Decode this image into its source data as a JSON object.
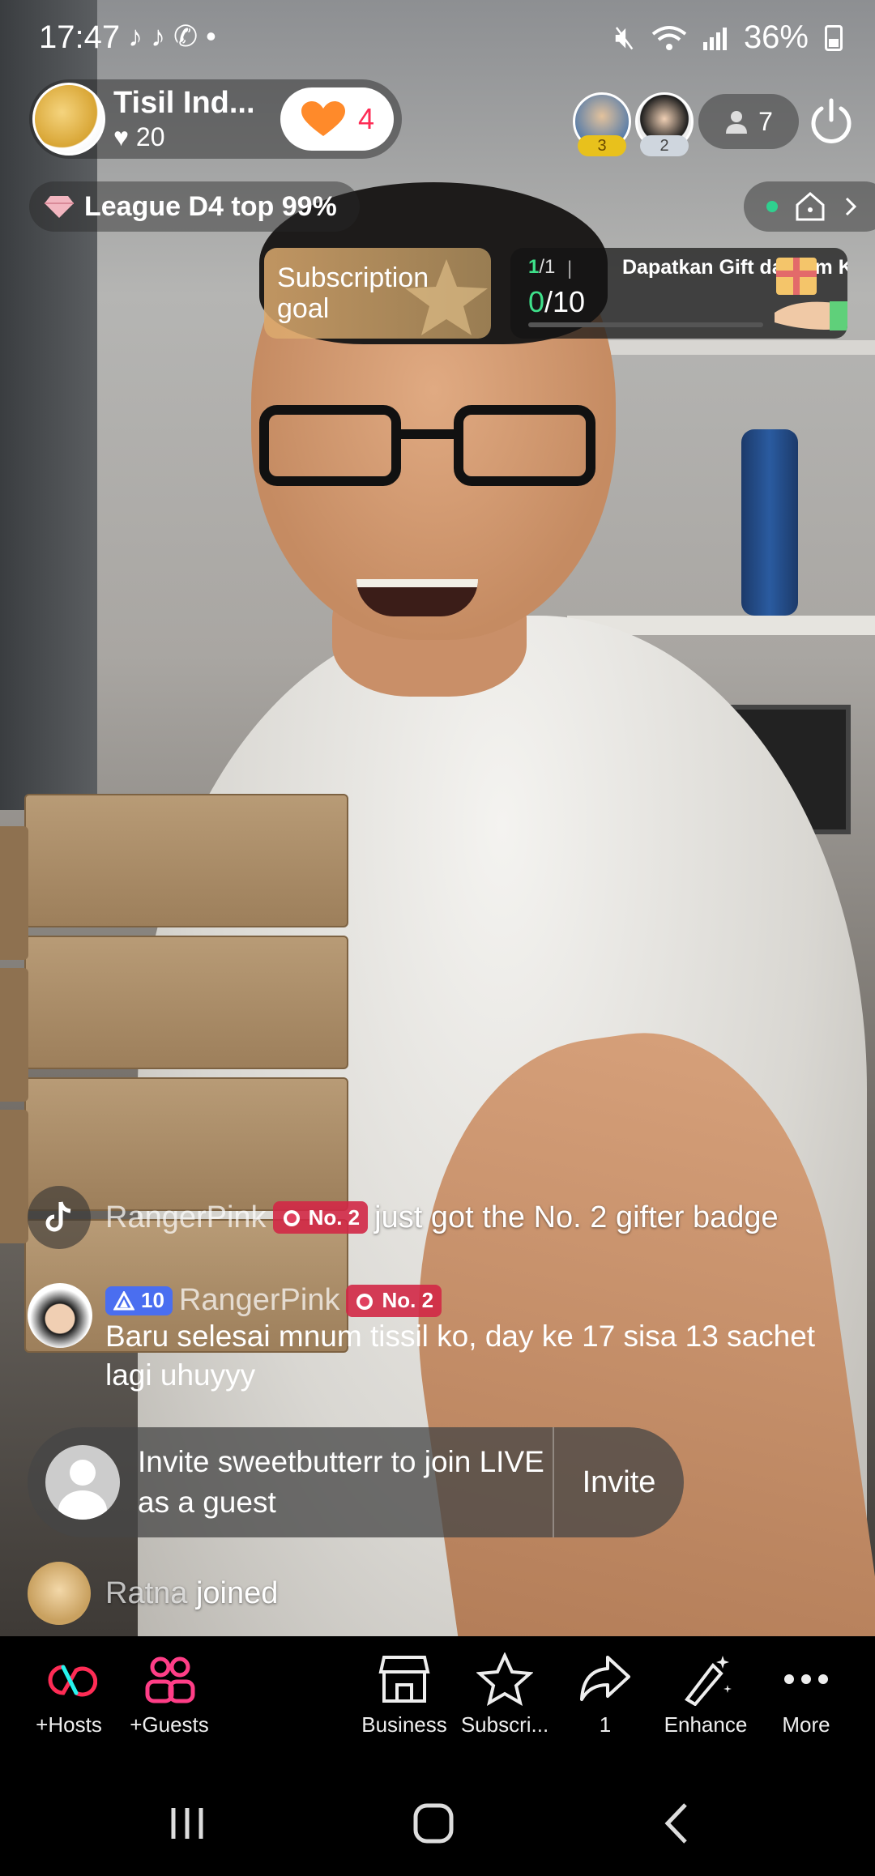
{
  "status_bar": {
    "time": "17:47",
    "battery": "36%",
    "app_icons": [
      "tiktok-icon",
      "tiktok-icon",
      "whatsapp-icon",
      "dot-icon"
    ]
  },
  "host": {
    "name": "Tisil Ind...",
    "likes": "20",
    "follow_count": "4"
  },
  "viewers": {
    "top": [
      {
        "badge": "3"
      },
      {
        "badge": "2"
      }
    ],
    "count": "7"
  },
  "league": {
    "label": "League D4 top 99%"
  },
  "subscription_goal": {
    "label": "Subscription goal"
  },
  "gift_goal": {
    "count_current": "1",
    "count_total": "/1",
    "title": "Dapatkan Gift dari tim K",
    "progress_current": "0",
    "progress_total": "/10",
    "progress_fraction": 0.0
  },
  "chat": {
    "system": {
      "user": "RangerPink",
      "badge": "No. 2",
      "text": "just got the No. 2 gifter badge"
    },
    "message": {
      "level": "10",
      "user": "RangerPink",
      "badge": "No. 2",
      "text": "Baru selesai mnum tissil ko, day ke 17 sisa 13 sachet lagi uhuyyy"
    },
    "invite": {
      "text": "Invite sweetbutterr to join LIVE as a guest",
      "button": "Invite"
    },
    "joined": {
      "user": "Ratna",
      "text": "joined"
    }
  },
  "toolbar": {
    "items": [
      {
        "label": "+Hosts",
        "icon": "hosts-icon"
      },
      {
        "label": "+Guests",
        "icon": "guests-icon"
      },
      {
        "label": "Business",
        "icon": "store-icon"
      },
      {
        "label": "Subscri...",
        "icon": "star-icon"
      },
      {
        "label": "1",
        "icon": "share-icon"
      },
      {
        "label": "Enhance",
        "icon": "wand-icon"
      },
      {
        "label": "More",
        "icon": "more-icon"
      }
    ]
  },
  "colors": {
    "accent_pink": "#fe2c55",
    "accent_cyan": "#25f4ee",
    "goal_green": "#3ee08a",
    "level_blue": "#4a6ef0"
  }
}
